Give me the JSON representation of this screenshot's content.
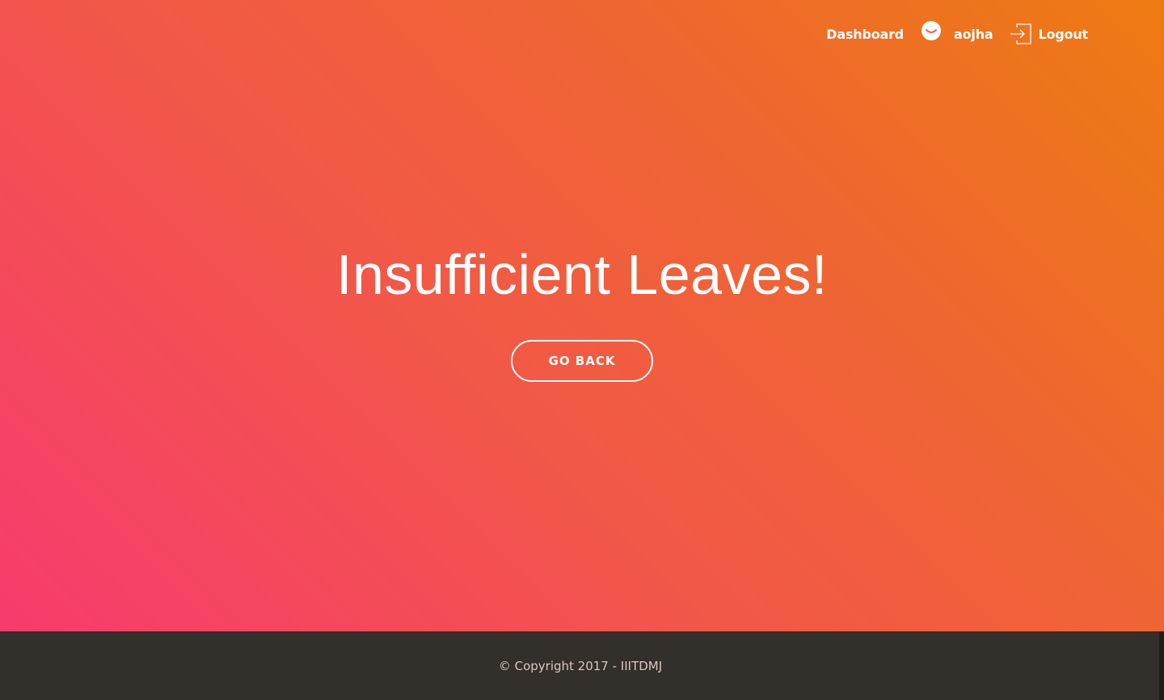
{
  "nav": {
    "dashboard_label": "Dashboard",
    "user_icon": "smile-icon",
    "username": "aojha",
    "logout_icon": "logout-icon",
    "logout_label": "Logout"
  },
  "hero": {
    "title": "Insufficient Leaves!",
    "go_back_label": "GO BACK"
  },
  "footer": {
    "copyright": "© Copyright 2017 - IIITDMJ"
  },
  "colors": {
    "gradient_start": "#f73b6e",
    "gradient_end": "#ee7b12",
    "footer_bg": "#332f2b",
    "footer_text": "#d8c8bd"
  }
}
